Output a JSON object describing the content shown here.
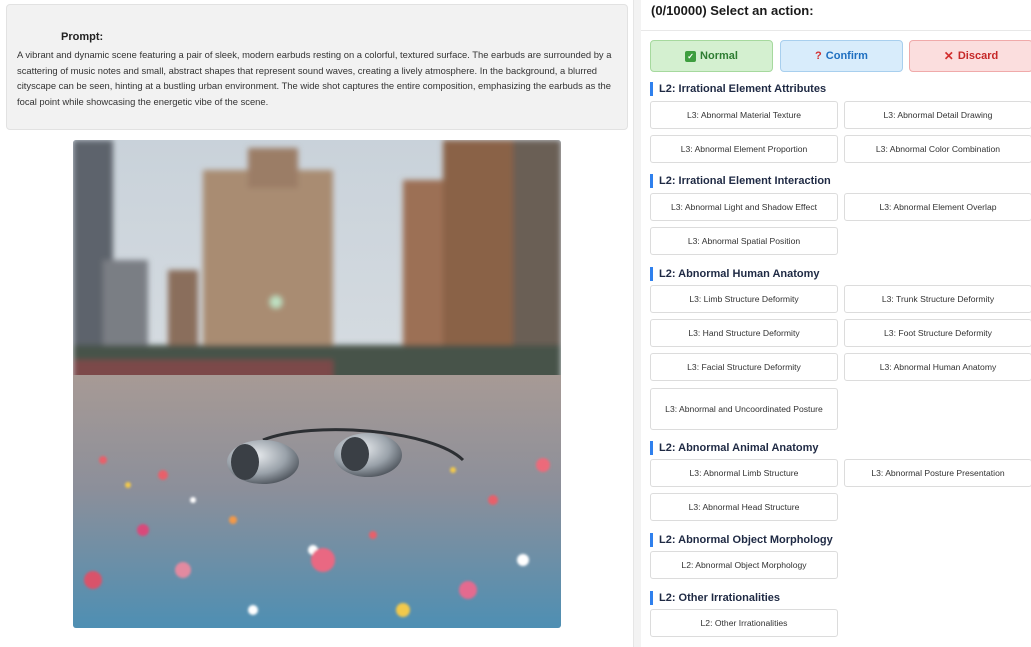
{
  "prompt": {
    "title": "Prompt:",
    "text": "A vibrant and dynamic scene featuring a pair of sleek, modern earbuds resting on a colorful, textured surface. The earbuds are surrounded by a scattering of music notes and small, abstract shapes that represent sound waves, creating a lively atmosphere. In the background, a blurred cityscape can be seen, hinting at a bustling urban environment. The wide shot captures the entire composition, emphasizing the earbuds as the focal point while showcasing the energetic vibe of the scene."
  },
  "actions": {
    "header": "(0/10000) Select an action:",
    "normal": "Normal",
    "confirm": "Confirm",
    "discard": "Discard"
  },
  "icons": {
    "normal": "check-square-icon",
    "confirm": "question-mark-icon",
    "discard": "x-mark-icon"
  },
  "colors": {
    "accent": "#2f80ed",
    "normal_bg": "#d4f0d0",
    "confirm_bg": "#d8ecfb",
    "discard_bg": "#fbdede"
  },
  "groups": [
    {
      "title": "L2: Irrational Element Attributes",
      "items": [
        "L3: Abnormal Material Texture",
        "L3: Abnormal Detail Drawing",
        "L3: Abnormal Element Proportion",
        "L3: Abnormal Color Combination"
      ]
    },
    {
      "title": "L2: Irrational Element Interaction",
      "items": [
        "L3: Abnormal Light and Shadow Effect",
        "L3: Abnormal Element Overlap",
        "L3: Abnormal Spatial Position"
      ]
    },
    {
      "title": "L2: Abnormal Human Anatomy",
      "items": [
        "L3: Limb Structure Deformity",
        "L3: Trunk Structure Deformity",
        "L3: Hand Structure Deformity",
        "L3: Foot Structure Deformity",
        "L3: Facial Structure Deformity",
        "L3: Abnormal Human Anatomy",
        "L3: Abnormal and Uncoordinated Posture"
      ]
    },
    {
      "title": "L2: Abnormal Animal Anatomy",
      "items": [
        "L3: Abnormal Limb Structure",
        "L3: Abnormal Posture Presentation",
        "L3: Abnormal Head Structure"
      ]
    },
    {
      "title": "L2: Abnormal Object Morphology",
      "items": [
        "L2: Abnormal Object Morphology"
      ]
    },
    {
      "title": "L2: Other Irrationalities",
      "items": [
        "L2: Other Irrationalities"
      ]
    }
  ]
}
